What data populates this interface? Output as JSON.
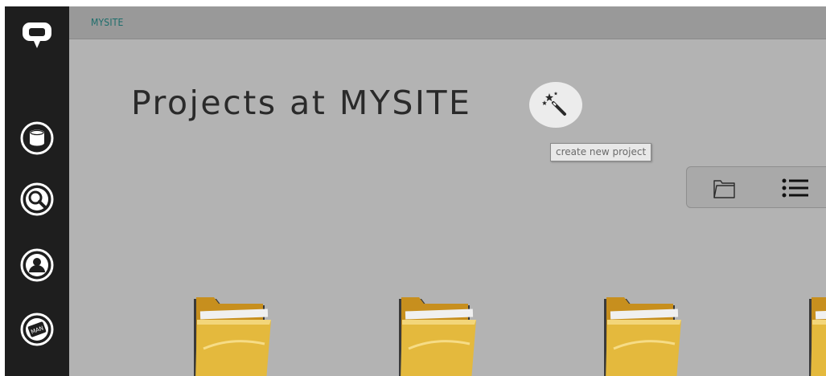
{
  "sidebar": {
    "items": [
      {
        "name": "logo-icon"
      },
      {
        "name": "database-icon"
      },
      {
        "name": "search-icon"
      },
      {
        "name": "user-icon"
      },
      {
        "name": "manual-icon",
        "label": "MAN"
      }
    ]
  },
  "header": {
    "breadcrumb": "MYSITE"
  },
  "main": {
    "title": "Projects at MYSITE",
    "create_tooltip": "create new project",
    "view_toggle": [
      "folder-view-icon",
      "list-view-icon"
    ],
    "folders": [
      "folder-icon",
      "folder-icon",
      "folder-icon",
      "folder-icon"
    ]
  },
  "colors": {
    "sidebar": "#1e1e1e",
    "topbar": "#999999",
    "content": "#b3b3b3",
    "breadcrumb": "#1d6d6b",
    "folder": "#e3b340"
  }
}
